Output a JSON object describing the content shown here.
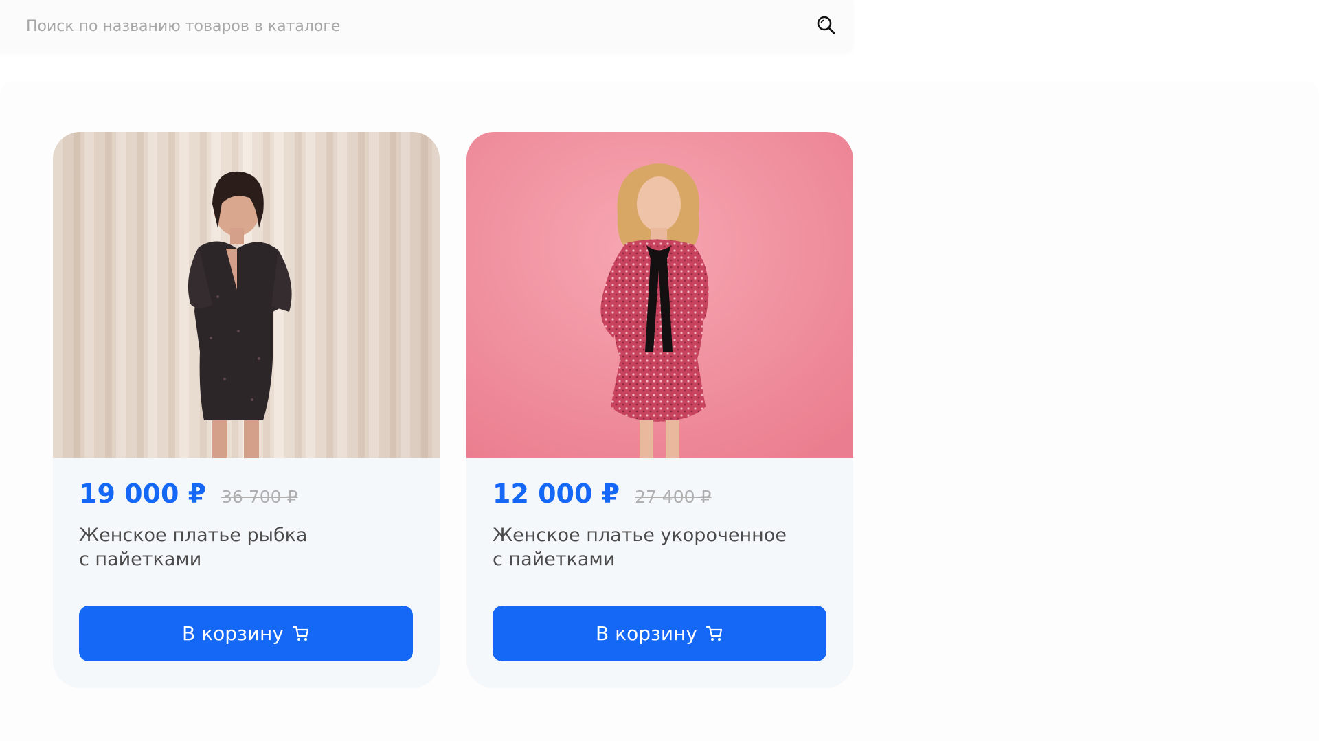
{
  "search": {
    "placeholder": "Поиск по названию товаров в каталоге",
    "icon": "search-icon"
  },
  "colors": {
    "accent": "#1468f5",
    "card_background": "#f5f8fb",
    "old_price": "#b0b0b0",
    "title_text": "#4b4b4b"
  },
  "products": [
    {
      "price": "19 000 ₽",
      "old_price": "36 700 ₽",
      "title_line1": "Женское платье рыбка",
      "title_line2": "с пайетками",
      "button_label": "В корзину",
      "button_icon": "cart-icon"
    },
    {
      "price": "12 000 ₽",
      "old_price": "27 400 ₽",
      "title_line1": "Женское платье укороченное",
      "title_line2": "с пайетками",
      "button_label": "В корзину",
      "button_icon": "cart-icon"
    }
  ]
}
